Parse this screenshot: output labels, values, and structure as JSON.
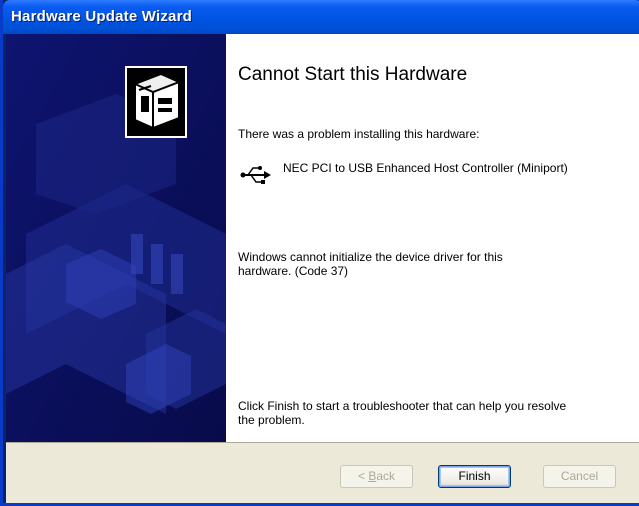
{
  "window": {
    "title": "Hardware Update Wizard"
  },
  "main": {
    "heading": "Cannot Start this Hardware",
    "intro": "There was a problem installing this hardware:",
    "device_name": "NEC PCI to USB Enhanced Host Controller (Miniport)",
    "error_line1": "Windows cannot initialize the device driver for this",
    "error_line2": "hardware. (Code 37)",
    "finish_line1": "Click Finish to start a troubleshooter that can help you resolve",
    "finish_line2": "the problem."
  },
  "buttons": {
    "back_prefix": "< ",
    "back_mnemonic": "B",
    "back_rest": "ack",
    "finish": "Finish",
    "cancel": "Cancel"
  },
  "icons": {
    "wizard_graphic": "hardware-box-icon",
    "device": "usb-icon"
  },
  "colors": {
    "titlebar": "#0054E3",
    "side_panel": "#0B0F5E",
    "footer": "#ECE9D8"
  }
}
